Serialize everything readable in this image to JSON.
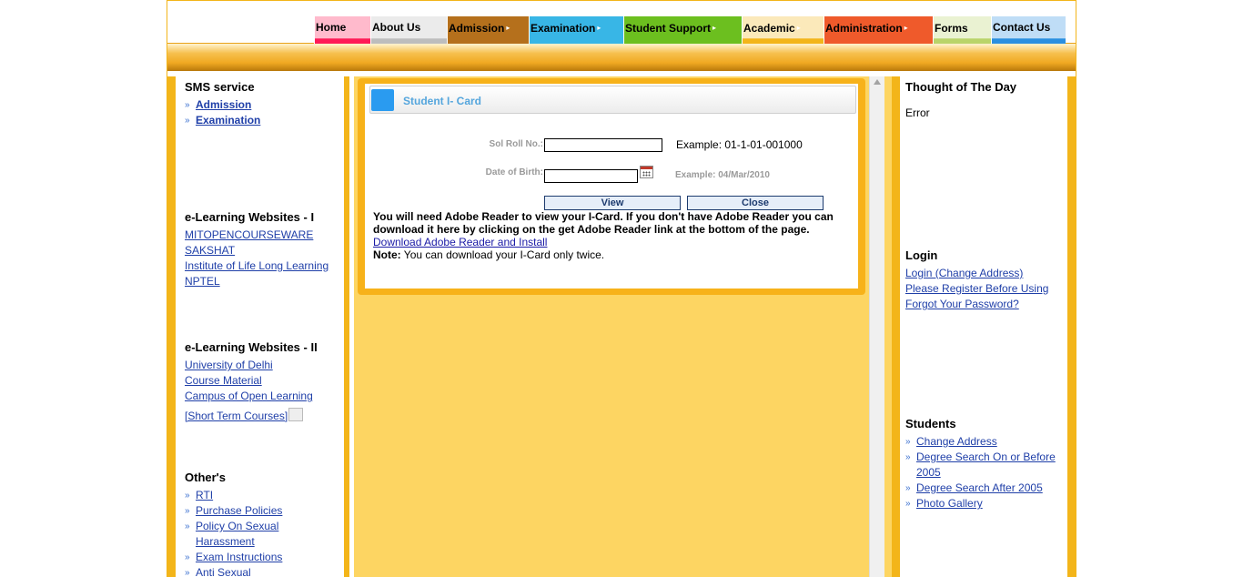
{
  "nav": [
    {
      "label": "Home",
      "color": "#ff1a56",
      "has_arrow": false
    },
    {
      "label": "About Us",
      "color": "#bdbdbd",
      "has_arrow": false
    },
    {
      "label": "Admission",
      "color": "#b5701c",
      "has_arrow": true
    },
    {
      "label": "Examination",
      "color": "#38b6e6",
      "has_arrow": true
    },
    {
      "label": "Student Support",
      "color": "#6cbf1f",
      "has_arrow": true
    },
    {
      "label": "Academic",
      "color": "#f3b51a",
      "has_arrow": true
    },
    {
      "label": "Administration",
      "color": "#ef5a2b",
      "has_arrow": true
    },
    {
      "label": "Forms",
      "color": "#b9d46a",
      "has_arrow": false
    },
    {
      "label": "Contact Us",
      "color": "#2a8fe0",
      "has_arrow": false
    }
  ],
  "left": {
    "sms": {
      "title": "SMS service",
      "items": [
        "Admission",
        "Examination"
      ]
    },
    "elearn1": {
      "title": "e-Learning Websites - I",
      "links": [
        "MITOPENCOURSEWARE",
        "SAKSHAT",
        "Institute of Life Long Learning",
        "NPTEL"
      ]
    },
    "elearn2": {
      "title": "e-Learning Websites - II",
      "links": [
        "University of Delhi",
        "Course Material",
        "Campus of Open Learning",
        "[Short Term Courses]"
      ]
    },
    "others": {
      "title": "Other's",
      "items": [
        "RTI",
        "Purchase Policies",
        "Policy On Sexual Harassment",
        "Exam Instructions",
        "Anti Sexual"
      ]
    }
  },
  "main": {
    "panel_title": "Student I- Card",
    "roll_label": "Sol Roll No.:",
    "roll_value": "",
    "roll_example": "Example: 01-1-01-001000",
    "dob_label": "Date of Birth:",
    "dob_value": "",
    "dob_example": "Example: 04/Mar/2010",
    "view_button": "View",
    "close_button": "Close",
    "note_bold": "You will need Adobe Reader to view your I-Card. If you don't have Adobe Reader you can download it here by clicking on the get Adobe Reader link at the bottom of the page.",
    "download_link": "Download Adobe Reader and Install",
    "note_label": "Note:",
    "note_text": "You can download your I-Card only twice."
  },
  "right": {
    "thought": {
      "title": "Thought of The Day",
      "text": "Error"
    },
    "login": {
      "title": "Login",
      "links": [
        "Login (Change Address)",
        "Please Register Before Using",
        "Forgot Your Password?"
      ]
    },
    "students": {
      "title": "Students",
      "items": [
        "Change Address",
        "Degree Search On or Before 2005",
        "Degree Search After 2005",
        "Photo Gallery"
      ]
    }
  }
}
